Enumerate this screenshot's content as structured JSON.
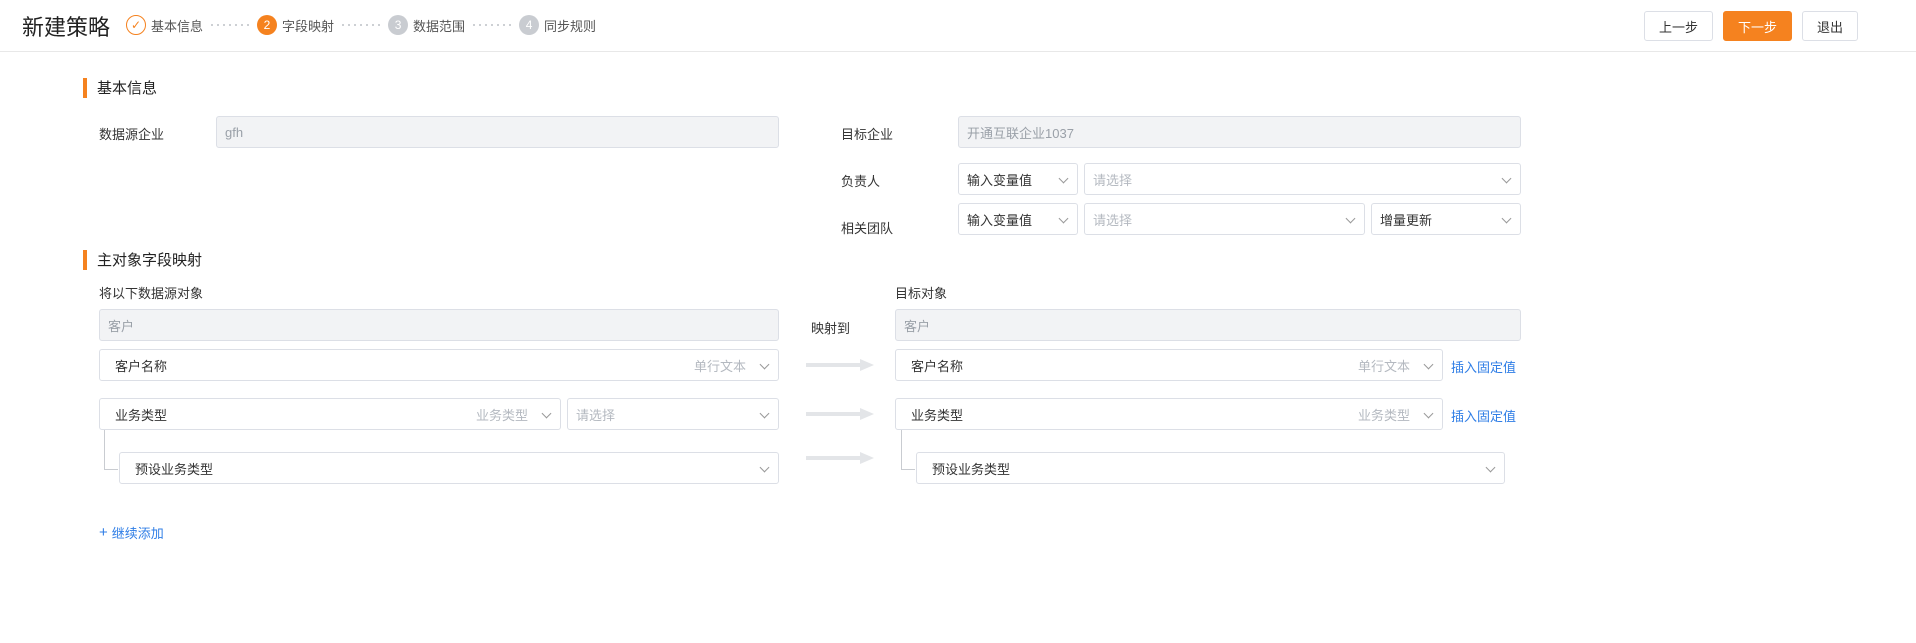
{
  "header": {
    "title": "新建策略",
    "steps": [
      {
        "num": "✓",
        "label": "基本信息",
        "state": "done"
      },
      {
        "num": "2",
        "label": "字段映射",
        "state": "active"
      },
      {
        "num": "3",
        "label": "数据范围",
        "state": "pending"
      },
      {
        "num": "4",
        "label": "同步规则",
        "state": "pending"
      }
    ],
    "prev_label": "上一步",
    "next_label": "下一步",
    "exit_label": "退出"
  },
  "basic_info": {
    "section_title": "基本信息",
    "source_label": "数据源企业",
    "source_value": "gfh",
    "target_label": "目标企业",
    "target_value": "开通互联企业1037",
    "owner_label": "负责人",
    "owner_mode": "输入变量值",
    "owner_placeholder": "请选择",
    "team_label": "相关团队",
    "team_mode": "输入变量值",
    "team_placeholder": "请选择",
    "team_update": "增量更新"
  },
  "mapping": {
    "section_title": "主对象字段映射",
    "source_header": "将以下数据源对象",
    "target_header": "目标对象",
    "source_object": "客户",
    "map_to_label": "映射到",
    "target_object": "客户",
    "rows": [
      {
        "src_field": "客户名称",
        "src_type": "单行文本",
        "dst_field": "客户名称",
        "dst_type": "单行文本",
        "insert_label": "插入固定值"
      },
      {
        "src_field": "业务类型",
        "src_type": "业务类型",
        "src_placeholder": "请选择",
        "dst_field": "业务类型",
        "dst_type": "业务类型",
        "insert_label": "插入固定值"
      }
    ],
    "sub_src": "预设业务类型",
    "sub_dst": "预设业务类型",
    "add_more": "继续添加"
  },
  "colors": {
    "accent": "#f5821f",
    "link": "#2f7ee6",
    "border": "#dcdfe6",
    "disabled_bg": "#f2f3f5"
  }
}
